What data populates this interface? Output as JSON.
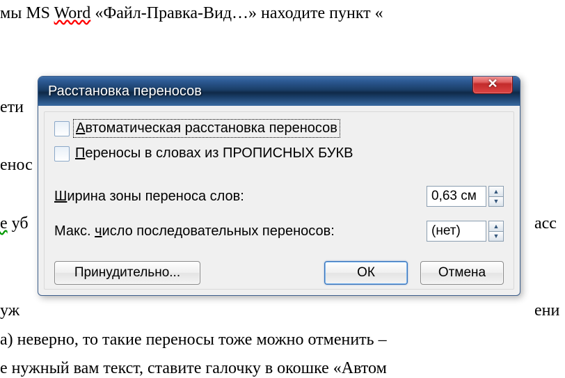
{
  "doc": {
    "line1_a": "мы MS ",
    "line1_b": "Word",
    "line1_c": " «Файл-Правка-Вид…» находите пункт «",
    "line2": "ети",
    "line3": "енос",
    "line4a": "е",
    "line4b": " уб",
    "line4_right": "асс",
    "line5": "уж",
    "line5_right": "ени",
    "line6": "а) неверно, то такие переносы тоже можно отменить –",
    "line7": "е нужный вам текст, ставите галочку в окошке «Автом"
  },
  "dialog": {
    "title": "Расстановка переносов",
    "close_tooltip": "Закрыть",
    "check1_pre": "А",
    "check1_rest": "втоматическая расстановка переносов",
    "check2_pre": "П",
    "check2_rest": "ереносы в словах из ПРОПИСНЫХ БУКВ",
    "width_label_pre": "Ш",
    "width_label_rest": "ирина зоны переноса слов:",
    "width_value": "0,63 см",
    "max_label_a": "Макс. ",
    "max_label_u": "ч",
    "max_label_b": "исло последовательных переносов:",
    "max_value": "(нет)",
    "btn_manual": "Принудительно...",
    "btn_ok": "ОК",
    "btn_cancel": "Отмена"
  }
}
